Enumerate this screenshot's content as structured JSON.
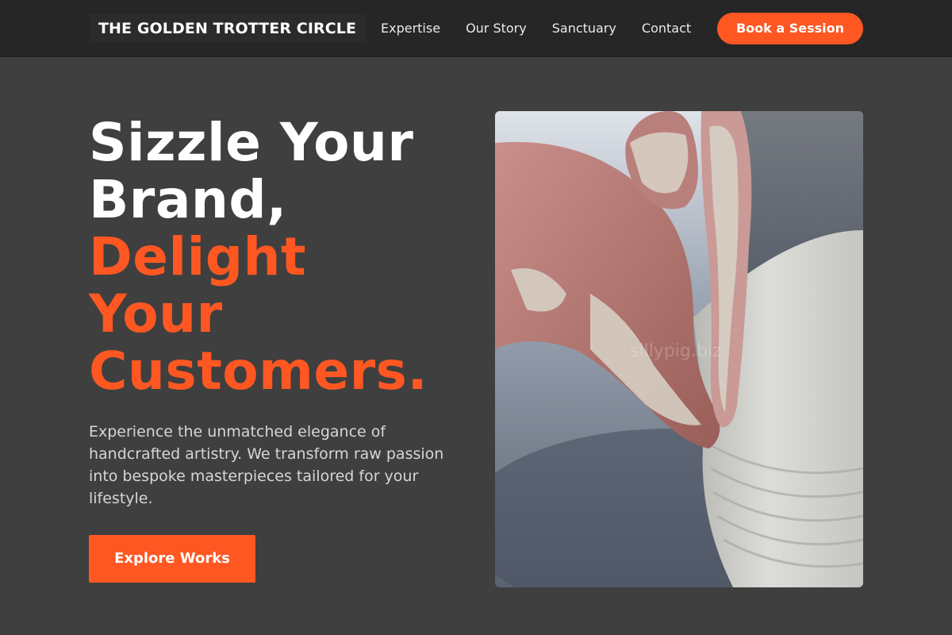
{
  "header": {
    "brand": "THE GOLDEN TROTTER CIRCLE",
    "nav": [
      {
        "label": "Expertise"
      },
      {
        "label": "Our Story"
      },
      {
        "label": "Sanctuary"
      },
      {
        "label": "Contact"
      }
    ],
    "cta_label": "Book a Session"
  },
  "hero": {
    "title_white": [
      "Sizzle Your",
      "Brand,"
    ],
    "title_accent": [
      "Delight",
      "Your",
      "Customers."
    ],
    "description": "Experience the unmatched elegance of handcrafted artistry. We transform raw passion into bespoke masterpieces tailored for your lifestyle.",
    "button_label": "Explore Works",
    "image_watermark": "sillypig.biz"
  },
  "colors": {
    "accent": "#ff5722",
    "background": "#3f3f3f",
    "header_background": "#262626"
  }
}
